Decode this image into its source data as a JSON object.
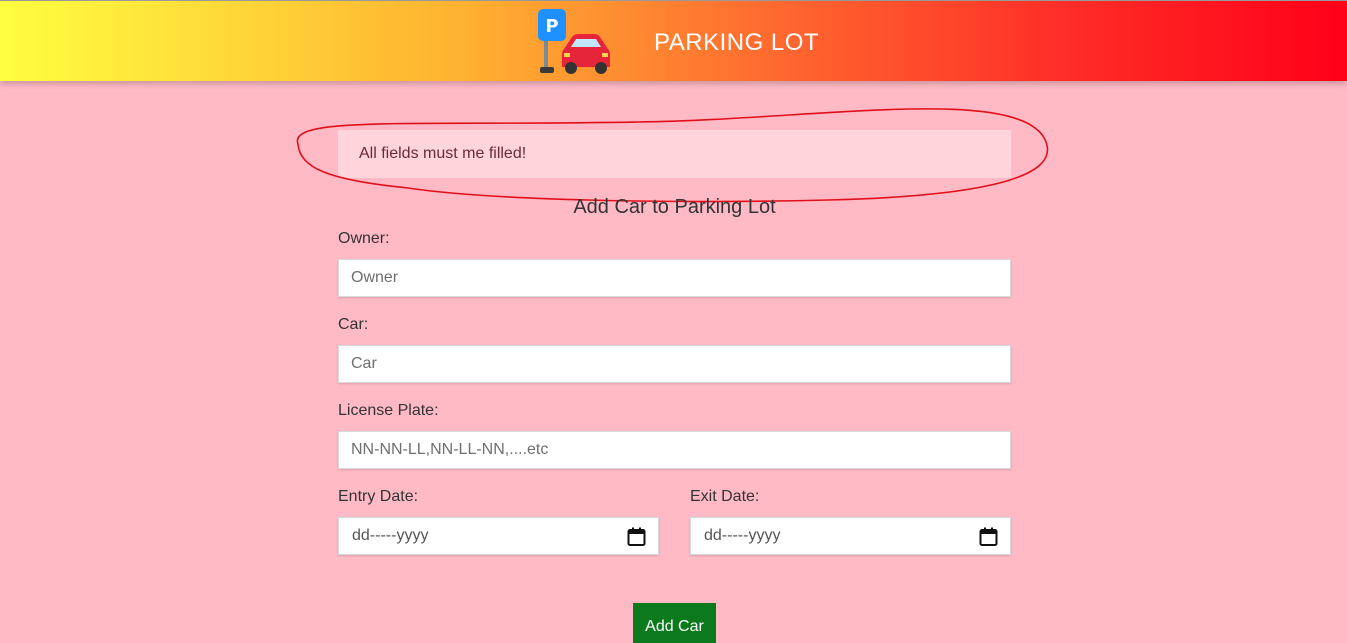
{
  "header": {
    "title": "PARKING LOT",
    "logo_icon": "parking-car-icon",
    "gradient": [
      "#ffff40",
      "#ffb030",
      "#ff3028",
      "#ff0018"
    ]
  },
  "alert": {
    "message": "All fields must me filled!"
  },
  "form": {
    "title": "Add Car to Parking Lot",
    "owner": {
      "label": "Owner:",
      "placeholder": "Owner",
      "value": ""
    },
    "car": {
      "label": "Car:",
      "placeholder": "Car",
      "value": ""
    },
    "plate": {
      "label": "License Plate:",
      "placeholder": "NN-NN-LL,NN-LL-NN,....etc",
      "value": ""
    },
    "entry_date": {
      "label": "Entry Date:",
      "placeholder": "dd-----yyyy"
    },
    "exit_date": {
      "label": "Exit Date:",
      "placeholder": "dd-----yyyy"
    },
    "submit_label": "Add Car"
  },
  "colors": {
    "background": "#ffbac6",
    "alert_bg": "#ffd4da",
    "submit_bg": "#0a7a1c",
    "annotation": "#e0101a"
  }
}
